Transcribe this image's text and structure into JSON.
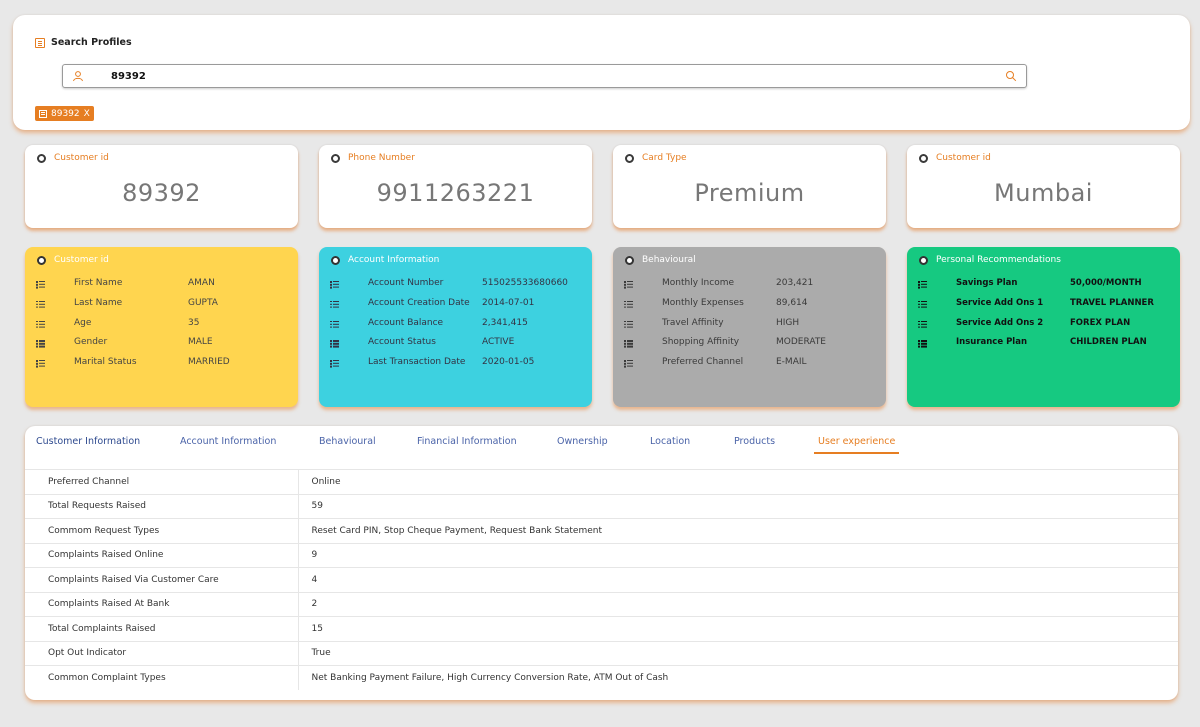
{
  "search": {
    "title": "Search Profiles",
    "value": "89392",
    "chip": "89392",
    "chip_close": "X"
  },
  "stats": [
    {
      "label": "Customer id",
      "value": "89392"
    },
    {
      "label": "Phone Number",
      "value": "9911263221"
    },
    {
      "label": "Card Type",
      "value": "Premium"
    },
    {
      "label": "Customer id",
      "value": "Mumbai"
    }
  ],
  "customer_card": {
    "title": "Customer id",
    "rows": [
      {
        "k": "First Name",
        "v": "AMAN"
      },
      {
        "k": "Last Name",
        "v": "GUPTA"
      },
      {
        "k": "Age",
        "v": "35"
      },
      {
        "k": "Gender",
        "v": "MALE"
      },
      {
        "k": "Marital Status",
        "v": "MARRIED"
      }
    ]
  },
  "account_card": {
    "title": "Account Information",
    "rows": [
      {
        "k": "Account Number",
        "v": "515025533680660"
      },
      {
        "k": "Account Creation Date",
        "v": "2014-07-01"
      },
      {
        "k": "Account Balance",
        "v": "2,341,415"
      },
      {
        "k": "Account Status",
        "v": "ACTIVE"
      },
      {
        "k": "Last Transaction Date",
        "v": "2020-01-05"
      }
    ]
  },
  "behaviour_card": {
    "title": "Behavioural",
    "rows": [
      {
        "k": "Monthly Income",
        "v": "203,421"
      },
      {
        "k": "Monthly Expenses",
        "v": "89,614"
      },
      {
        "k": "Travel Affinity",
        "v": "HIGH"
      },
      {
        "k": "Shopping Affinity",
        "v": "MODERATE"
      },
      {
        "k": "Preferred Channel",
        "v": "E-MAIL"
      }
    ]
  },
  "reco_card": {
    "title": "Personal Recommendations",
    "rows": [
      {
        "k": "Savings Plan",
        "v": "50,000/MONTH"
      },
      {
        "k": "Service Add Ons 1",
        "v": "TRAVEL PLANNER"
      },
      {
        "k": "Service Add Ons 2",
        "v": "FOREX PLAN"
      },
      {
        "k": "Insurance Plan",
        "v": "CHILDREN PLAN"
      }
    ]
  },
  "tabs": [
    "Customer Information",
    "Account Information",
    "Behavioural",
    "Financial Information",
    "Ownership",
    "Location",
    "Products",
    "User experience"
  ],
  "active_tab": "User experience",
  "table": [
    {
      "k": "Preferred Channel",
      "v": "Online"
    },
    {
      "k": "Total Requests Raised",
      "v": "59"
    },
    {
      "k": "Commom Request Types",
      "v": "Reset Card PIN, Stop Cheque Payment, Request Bank Statement"
    },
    {
      "k": "Complaints Raised Online",
      "v": "9"
    },
    {
      "k": "Complaints Raised Via Customer Care",
      "v": "4"
    },
    {
      "k": "Complaints Raised At Bank",
      "v": "2"
    },
    {
      "k": "Total Complaints Raised",
      "v": "15"
    },
    {
      "k": "Opt Out Indicator",
      "v": "True"
    },
    {
      "k": "Common Complaint Types",
      "v": "Net Banking Payment Failure, High Currency Conversion Rate, ATM Out of Cash"
    }
  ],
  "colors": {
    "accent": "#e67e22",
    "customer_card": "#ffd54f",
    "account_card": "#3dd1e0",
    "behaviour_card": "#ababab",
    "reco_card": "#16c981",
    "tab_text": "#4a63a8"
  }
}
